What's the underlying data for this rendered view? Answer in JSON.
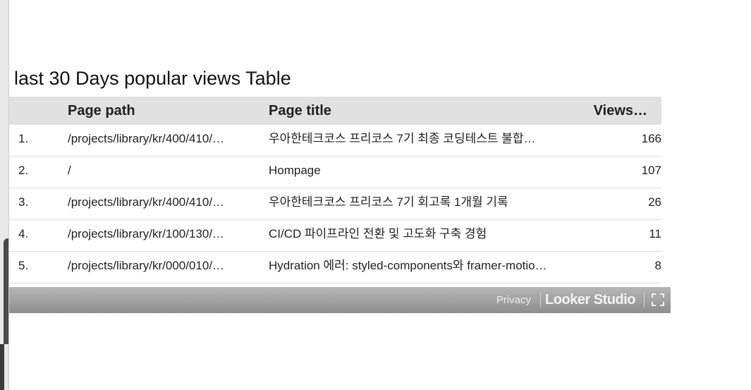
{
  "report": {
    "table_title": "last 30 Days popular views Table"
  },
  "table": {
    "headers": {
      "index": "",
      "path": "Page path",
      "title": "Page title",
      "views": "Views…"
    },
    "rows": [
      {
        "index": "1.",
        "path": "/projects/library/kr/400/410/…",
        "title": "우아한테크코스 프리코스 7기 최종 코딩테스트 불합…",
        "views": "166"
      },
      {
        "index": "2.",
        "path": "/",
        "title": "Hompage",
        "views": "107"
      },
      {
        "index": "3.",
        "path": "/projects/library/kr/400/410/…",
        "title": "우아한테크코스 프리코스 7기 회고록 1개월 기록",
        "views": "26"
      },
      {
        "index": "4.",
        "path": "/projects/library/kr/100/130/…",
        "title": "CI/CD 파이프라인 전환 및 고도화 구축 경험",
        "views": "11"
      },
      {
        "index": "5.",
        "path": "/projects/library/kr/000/010/…",
        "title": "Hydration 에러: styled-components와 framer-motio…",
        "views": "8"
      }
    ]
  },
  "footer": {
    "privacy_label": "Privacy",
    "brand_label": "Looker Studio",
    "fullscreen_icon": "fullscreen-icon"
  },
  "colors": {
    "header_bg": "#e1e1e1",
    "footer_bg": "#9e9e9e",
    "row_divider": "#dcdcdc"
  }
}
